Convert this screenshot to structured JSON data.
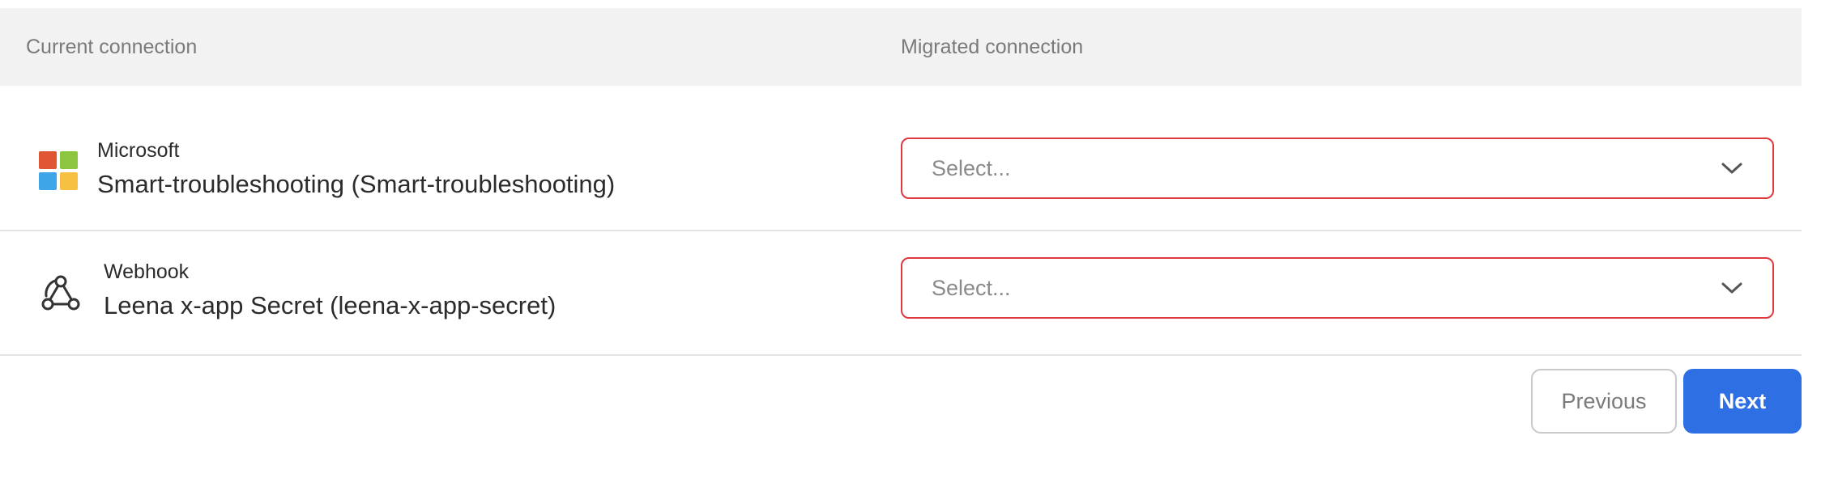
{
  "header": {
    "current_col": "Current connection",
    "migrated_col": "Migrated connection"
  },
  "rows": [
    {
      "provider": "Microsoft",
      "provider_icon": "microsoft-logo-icon",
      "connection": "Smart-troubleshooting (Smart-troubleshooting)",
      "select_placeholder": "Select..."
    },
    {
      "provider": "Webhook",
      "provider_icon": "webhook-icon",
      "connection": "Leena x-app Secret (leena-x-app-secret)",
      "select_placeholder": "Select..."
    }
  ],
  "footer": {
    "previous_label": "Previous",
    "next_label": "Next"
  },
  "colors": {
    "error_border": "#e0393e",
    "primary": "#2f6fe4",
    "header_bg": "#f2f2f2"
  }
}
